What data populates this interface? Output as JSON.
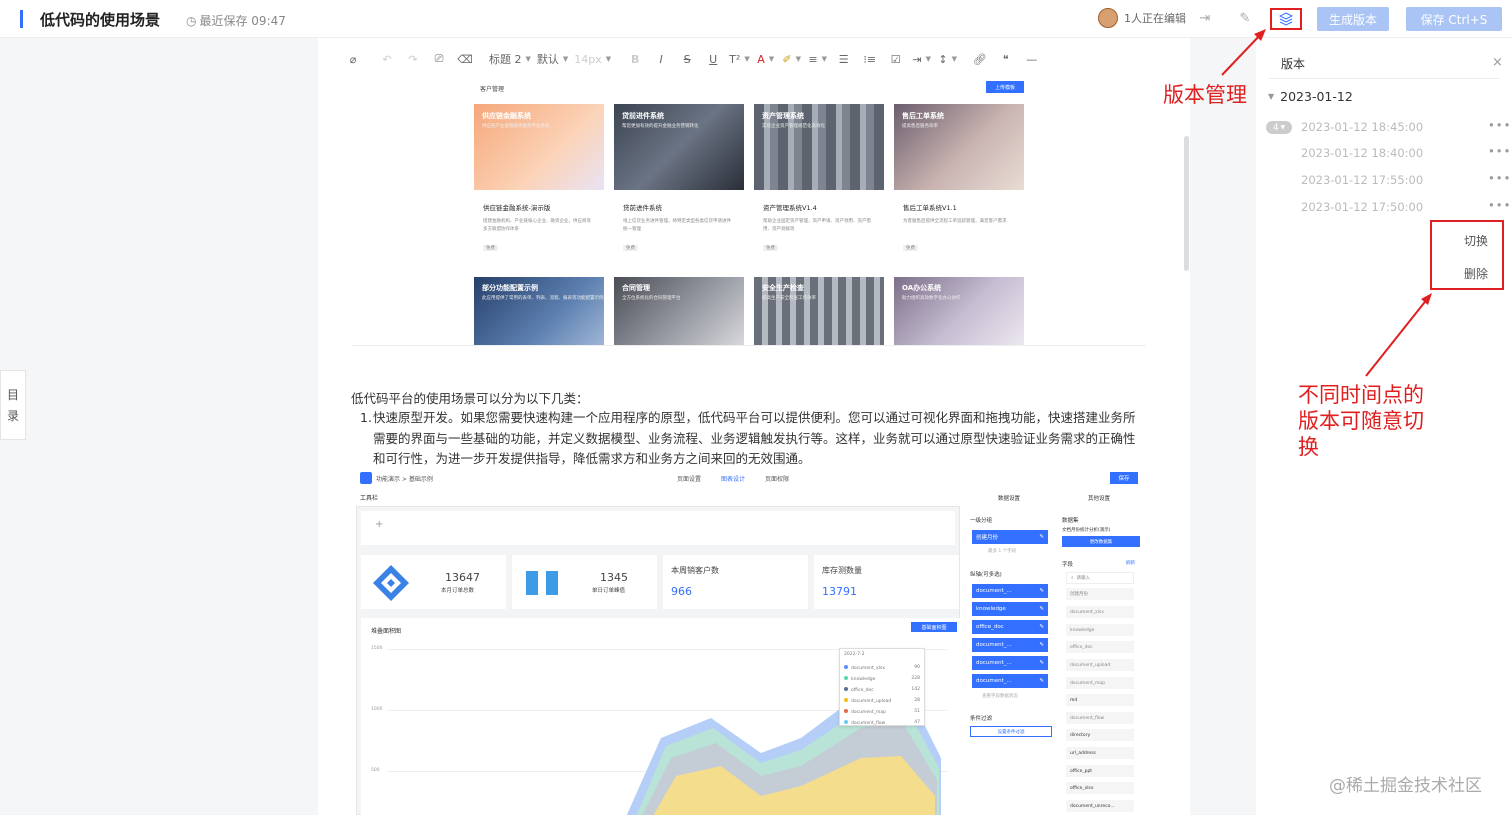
{
  "header": {
    "doc_title": "低代码的使用场景",
    "save_status": "最近保存 09:47",
    "editors": "1人正在编辑",
    "generate_version": "生成版本",
    "save_button": "保存 Ctrl+S"
  },
  "toolbar": {
    "heading": "标题 2",
    "font": "默认",
    "size": "14px"
  },
  "toc_label": [
    "目",
    "录"
  ],
  "gallery": {
    "title": "客户管理",
    "upload": "上传模板",
    "cards": [
      {
        "header": "供应链金融系统",
        "sub": "供应链产业金融融资服务平台系统",
        "name": "供应链金融系统-演示版",
        "desc": "搭建金融机构、产业链核心企业、融资企业，供应商等多方联盟协作体系",
        "tag": "免费"
      },
      {
        "header": "贷前进件系统",
        "sub": "帮您更加有效的提升金融业务营销转化",
        "name": "贷前进件系统",
        "desc": "线上信贷业务进件管理，将特定类型各类信贷申请进件统一管理",
        "tag": "免费"
      },
      {
        "header": "资产管理系统",
        "sub": "实现企业资产管理规范化高效化",
        "name": "资产管理系统V1.4",
        "desc": "帮助企业固定资产管理，资产申请、资产领用、资产借用、资产调拨等",
        "tag": "免费"
      },
      {
        "header": "售后工单系统",
        "sub": "提高售后服务效率",
        "name": "售后工单系统V1.1",
        "desc": "为客服售后提供全流程工单追踪管理，满足客户需求",
        "tag": "免费"
      }
    ],
    "cards_row2": [
      {
        "header": "部分功能配置示例",
        "sub": "此应用提供了常用的表单、列表、流程、报表等功能配置示例"
      },
      {
        "header": "合同管理",
        "sub": "全方位系统化的合同管理平台"
      },
      {
        "header": "安全生产检查",
        "sub": "提高生产安全检查工作效率"
      },
      {
        "header": "OA办公系统",
        "sub": "助力组织高效数字化办公协作"
      }
    ]
  },
  "content": {
    "intro": "低代码平台的使用场景可以分为以下几类：",
    "item_number": "1.",
    "item_text": "快速原型开发。如果您需要快速构建一个应用程序的原型，低代码平台可以提供便利。您可以通过可视化界面和拖拽功能，快速搭建业务所需要的界面与一些基础的功能，并定义数据模型、业务流程、业务逻辑触发执行等。这样，业务就可以通过原型快速验证业务需求的正确性和可行性，为进一步开发提供指导，降低需求方和业务方之间来回的无效围通。"
  },
  "dashboard": {
    "crumb": "功能演示 > 基础示例",
    "tabs": [
      "页面设置",
      "图表设计",
      "页面权限"
    ],
    "save": "保存",
    "toolbar_label": "工具栏",
    "plus": "+",
    "kpis": [
      {
        "num": "13647",
        "label": "本月订单总数"
      },
      {
        "num": "1345",
        "label": "单日订单峰值"
      },
      {
        "label": "本周销客户数",
        "num": "966"
      },
      {
        "label": "库存测数量",
        "num": "13791"
      }
    ],
    "chart_title": "堆叠面积图",
    "chart_button": "基础面积图",
    "yticks": [
      "1500",
      "1000",
      "500"
    ],
    "tooltip_title": "2022-7-2",
    "tooltip_rows": [
      {
        "name": "document_xlsx",
        "value": "90",
        "color": "#5b8ff9"
      },
      {
        "name": "knowledge",
        "value": "228",
        "color": "#5ad8a6"
      },
      {
        "name": "office_doc",
        "value": "142",
        "color": "#5d7092"
      },
      {
        "name": "document_upload",
        "value": "28",
        "color": "#f6bd16"
      },
      {
        "name": "document_map",
        "value": "51",
        "color": "#e8684a"
      },
      {
        "name": "document_flow",
        "value": "47",
        "color": "#6dc8ec"
      }
    ],
    "pane1": {
      "tab": "数据设置",
      "group": "一级分组",
      "group_item": "创建月份",
      "group_hint": "最多 1 个字段",
      "axis": "纵轴(可多选)",
      "axis_items": [
        "document_...",
        "knowledge",
        "office_doc",
        "document_...",
        "document_...",
        "document_..."
      ],
      "axis_hint": "查看字段数据状态",
      "filter": "条件过滤",
      "filter_btn": "设置条件过滤"
    },
    "pane2": {
      "tab": "其他设置",
      "dataset": "数据集",
      "dataset_name": "文档月份统计分析(演示)",
      "change": "更改数据集",
      "fields": "字段",
      "fields_link": "刷新",
      "search": "请输入",
      "field_list": [
        "创建月份",
        "document_xlsx",
        "knowledge",
        "office_doc",
        "document_upload",
        "document_map",
        "md",
        "document_flow",
        "directory",
        "url_address",
        "office_ppt",
        "office_xlsx",
        "document_unreco..."
      ]
    }
  },
  "version_panel": {
    "title": "版本",
    "close": "×",
    "date": "2023-01-12",
    "badge": "4",
    "versions": [
      "2023-01-12 18:45:00",
      "2023-01-12 18:40:00",
      "2023-01-12 17:55:00",
      "2023-01-12 17:50:00"
    ],
    "menu": [
      "切换",
      "删除"
    ]
  },
  "annotations": {
    "version_mgmt": "版本管理",
    "switch_note": "不同时间点的版本可随意切换"
  },
  "watermark": "@稀土掘金技术社区",
  "colors": {
    "accent": "#3370ff",
    "annotation": "#e02020"
  }
}
